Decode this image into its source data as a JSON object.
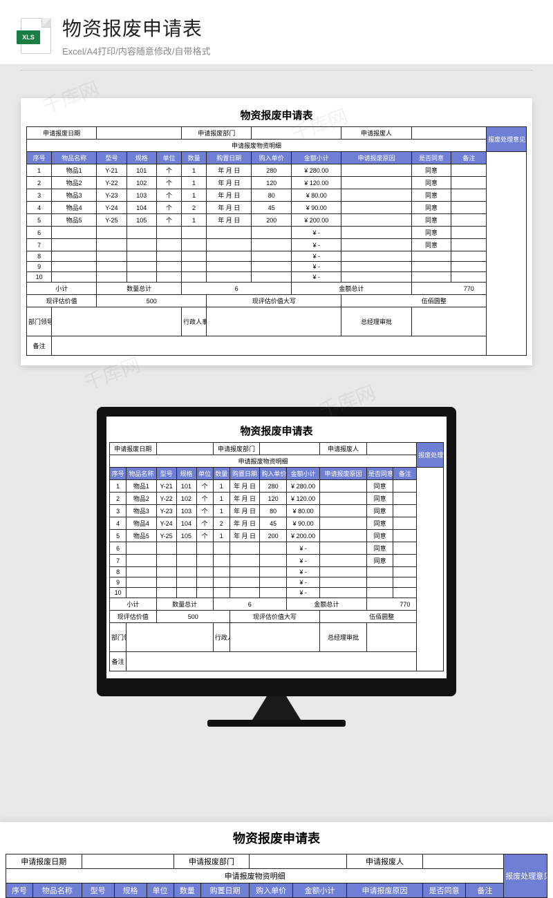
{
  "product": {
    "icon_label": "XLS",
    "title": "物资报废申请表",
    "subtitle": "Excel/A4打印/内容随意修改/自带格式"
  },
  "form": {
    "title": "物资报废申请表",
    "meta": {
      "date_label": "申请报废日期",
      "dept_label": "申请报废部门",
      "person_label": "申请报废人",
      "detail_header": "申请报废物资明细",
      "opinion_label": "报废处理意见"
    },
    "columns": {
      "seq": "序号",
      "name": "物品名称",
      "model": "型号",
      "spec": "规格",
      "unit": "单位",
      "qty": "数量",
      "buy_date": "购置日期",
      "unit_price": "购入单价",
      "subtotal": "金额小计",
      "reason": "申请报废原因",
      "agree": "是否同意",
      "remark": "备注"
    },
    "rows": [
      {
        "seq": "1",
        "name": "物品1",
        "model": "Y-21",
        "spec": "101",
        "unit": "个",
        "qty": "1",
        "buy_date": "年 月 日",
        "unit_price": "280",
        "subtotal": "280.00",
        "reason": "",
        "agree": "同意",
        "remark": ""
      },
      {
        "seq": "2",
        "name": "物品2",
        "model": "Y-22",
        "spec": "102",
        "unit": "个",
        "qty": "1",
        "buy_date": "年 月 日",
        "unit_price": "120",
        "subtotal": "120.00",
        "reason": "",
        "agree": "同意",
        "remark": ""
      },
      {
        "seq": "3",
        "name": "物品3",
        "model": "Y-23",
        "spec": "103",
        "unit": "个",
        "qty": "1",
        "buy_date": "年 月 日",
        "unit_price": "80",
        "subtotal": "80.00",
        "reason": "",
        "agree": "同意",
        "remark": ""
      },
      {
        "seq": "4",
        "name": "物品4",
        "model": "Y-24",
        "spec": "104",
        "unit": "个",
        "qty": "2",
        "buy_date": "年 月 日",
        "unit_price": "45",
        "subtotal": "90.00",
        "reason": "",
        "agree": "同意",
        "remark": ""
      },
      {
        "seq": "5",
        "name": "物品5",
        "model": "Y-25",
        "spec": "105",
        "unit": "个",
        "qty": "1",
        "buy_date": "年 月 日",
        "unit_price": "200",
        "subtotal": "200.00",
        "reason": "",
        "agree": "同意",
        "remark": ""
      },
      {
        "seq": "6",
        "name": "",
        "model": "",
        "spec": "",
        "unit": "",
        "qty": "",
        "buy_date": "",
        "unit_price": "",
        "subtotal": "-",
        "reason": "",
        "agree": "同意",
        "remark": ""
      },
      {
        "seq": "7",
        "name": "",
        "model": "",
        "spec": "",
        "unit": "",
        "qty": "",
        "buy_date": "",
        "unit_price": "",
        "subtotal": "-",
        "reason": "",
        "agree": "同意",
        "remark": ""
      },
      {
        "seq": "8",
        "name": "",
        "model": "",
        "spec": "",
        "unit": "",
        "qty": "",
        "buy_date": "",
        "unit_price": "",
        "subtotal": "-",
        "reason": "",
        "agree": "",
        "remark": ""
      },
      {
        "seq": "9",
        "name": "",
        "model": "",
        "spec": "",
        "unit": "",
        "qty": "",
        "buy_date": "",
        "unit_price": "",
        "subtotal": "-",
        "reason": "",
        "agree": "",
        "remark": ""
      },
      {
        "seq": "10",
        "name": "",
        "model": "",
        "spec": "",
        "unit": "",
        "qty": "",
        "buy_date": "",
        "unit_price": "",
        "subtotal": "-",
        "reason": "",
        "agree": "",
        "remark": ""
      }
    ],
    "totals": {
      "subtotal_label": "小计",
      "qty_total_label": "数量总计",
      "qty_total": "6",
      "amount_total_label": "金额总计",
      "amount_total": "770",
      "eval_label": "现评估价值",
      "eval_value": "500",
      "eval_cn_label": "现评估价值大写",
      "eval_cn_value": "伍佰圆整"
    },
    "sign": {
      "dept_leader": "部门领导",
      "hr": "行政人事",
      "gm": "总经理审批",
      "remark": "备注"
    }
  },
  "watermark": "千库网"
}
